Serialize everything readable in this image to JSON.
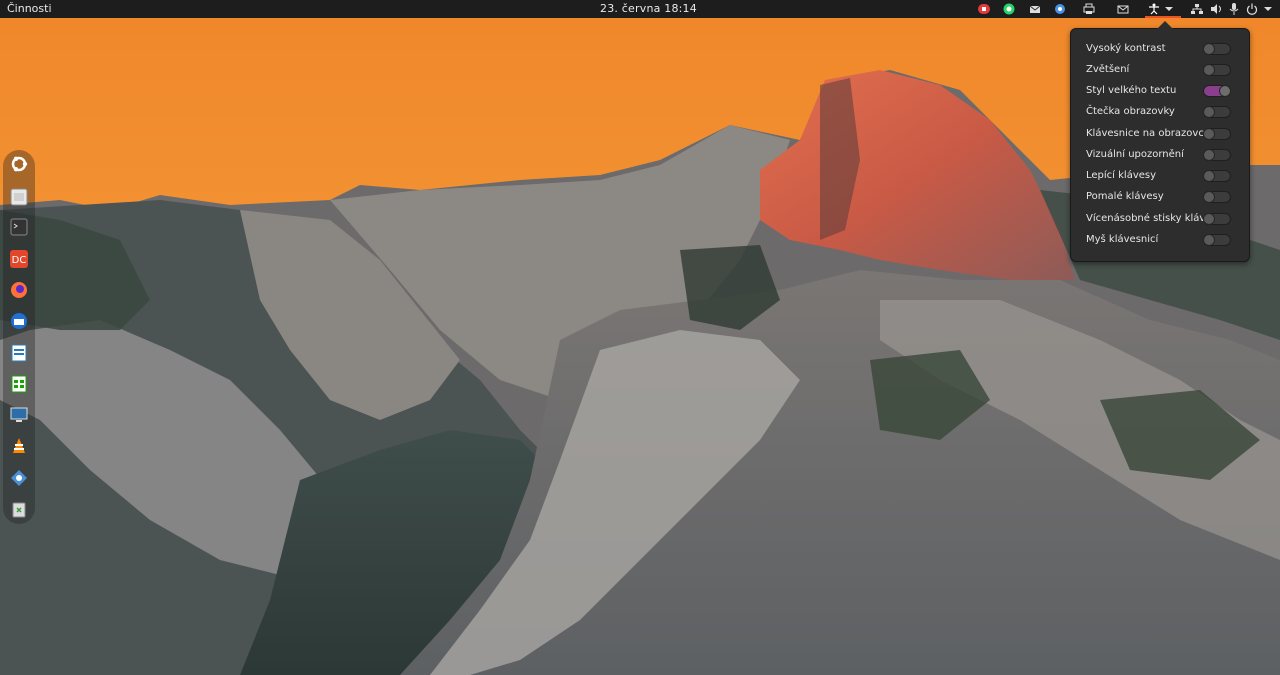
{
  "topbar": {
    "activities": "Činnosti",
    "clock": "23. června  18:14"
  },
  "tray_icons": [
    "red-notification-icon",
    "whatsapp-icon",
    "mail-icon",
    "chat-bubble-icon",
    "printer-icon",
    "mail-check-icon",
    "accessibility-icon",
    "chevron-down-icon",
    "network-icon",
    "volume-icon",
    "microphone-icon",
    "power-icon",
    "menu-arrow-icon"
  ],
  "dock_icons": [
    "ubuntu-logo-icon",
    "files-icon",
    "terminal-icon",
    "doublecmd-icon",
    "firefox-icon",
    "thunderbird-icon",
    "writer-icon",
    "calc-icon",
    "remote-desktop-icon",
    "vlc-icon",
    "kvm-icon",
    "trash-icon"
  ],
  "accessibility_menu": {
    "items": [
      {
        "label": "Vysoký kontrast",
        "on": false
      },
      {
        "label": "Zvětšení",
        "on": false
      },
      {
        "label": "Styl velkého textu",
        "on": true
      },
      {
        "label": "Čtečka obrazovky",
        "on": false
      },
      {
        "label": "Klávesnice na obrazovce",
        "on": false
      },
      {
        "label": "Vizuální upozornění",
        "on": false
      },
      {
        "label": "Lepící klávesy",
        "on": false
      },
      {
        "label": "Pomalé klávesy",
        "on": false
      },
      {
        "label": "Vícenásobné stisky kláves",
        "on": false
      },
      {
        "label": "Myš klávesnicí",
        "on": false
      }
    ]
  },
  "colors": {
    "accent": "#e95420",
    "switch_on": "#8a3f8c",
    "topbar": "#1d1d1d",
    "menu_bg": "#2d2d2d"
  }
}
